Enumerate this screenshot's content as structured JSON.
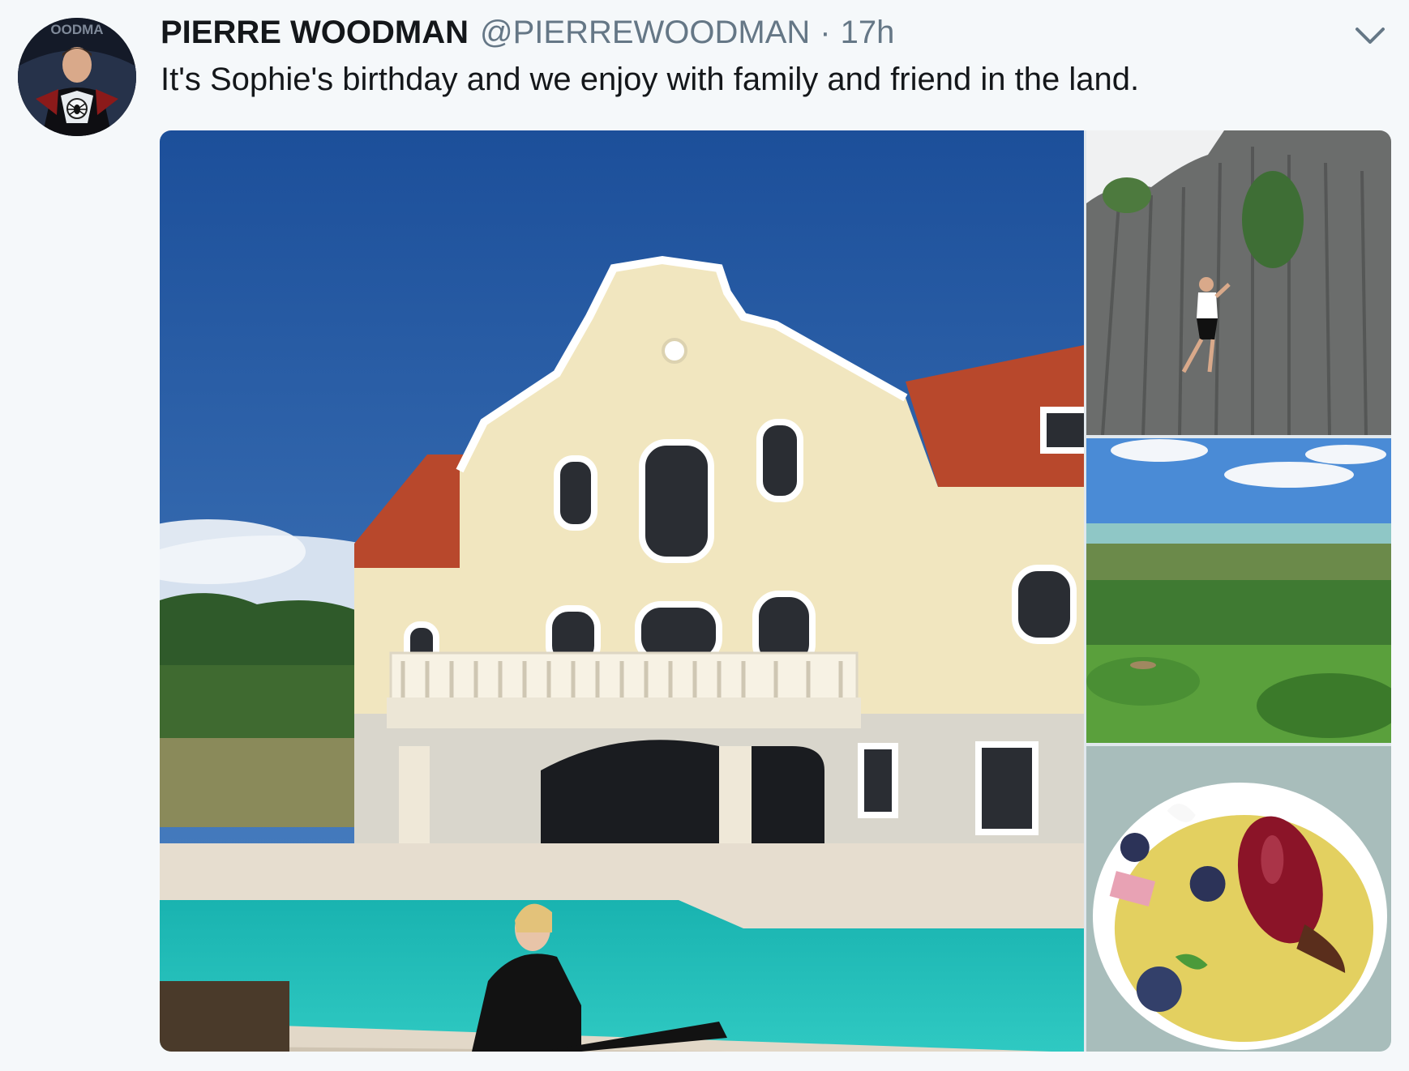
{
  "tweet": {
    "author_name": "PIERRE WOODMAN",
    "author_handle": "@PIERREWOODMAN",
    "separator": "·",
    "time": "17h",
    "text": "It's Sophie's birthday and we enjoy with family and friend in the land.",
    "avatar_text": "OODMA"
  },
  "icons": {
    "menu": "chevron-down-icon"
  },
  "colors": {
    "name": "#14171a",
    "meta": "#657786",
    "background": "#f5f8fa"
  },
  "media": {
    "photos": [
      {
        "subject": "villa-with-pool"
      },
      {
        "subject": "basalt-rock-climbing"
      },
      {
        "subject": "lake-vineyard-view"
      },
      {
        "subject": "dessert-creme-brulee"
      }
    ]
  }
}
